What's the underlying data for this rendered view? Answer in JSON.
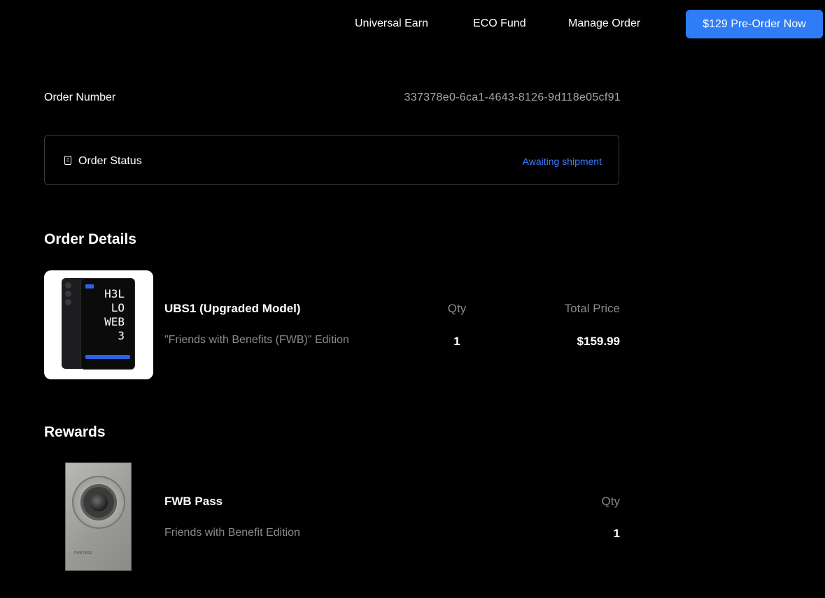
{
  "nav": {
    "links": [
      "Universal Earn",
      "ECO Fund",
      "Manage Order"
    ],
    "preorder_label": "$129 Pre-Order Now"
  },
  "order": {
    "number_label": "Order Number",
    "number_value": "337378e0-6ca1-4643-8126-9d118e05cf91",
    "status_label": "Order Status",
    "status_value": "Awaiting shipment"
  },
  "details": {
    "title": "Order Details",
    "product": {
      "name": "UBS1 (Upgraded Model)",
      "edition": "\"Friends with Benefits (FWB)\" Edition",
      "qty_label": "Qty",
      "qty": "1",
      "price_label": "Total Price",
      "price": "$159.99",
      "screen_text": "H3L\n LO\nWEB\n  3"
    }
  },
  "rewards": {
    "title": "Rewards",
    "item": {
      "name": "FWB Pass",
      "edition": "Friends with Benefit Edition",
      "qty_label": "Qty",
      "qty": "1",
      "thumb_text": "FWB PASS"
    }
  },
  "colors": {
    "background": "#000000",
    "accent": "#2f7cf6",
    "status": "#3c7bff",
    "muted_text": "#8a8a8a",
    "border": "#3a3a3a"
  },
  "icons": {
    "status": "document-icon"
  }
}
